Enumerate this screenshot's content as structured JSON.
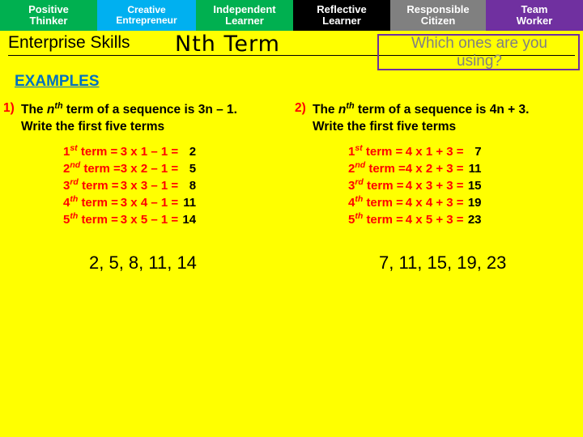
{
  "skills_bar": [
    {
      "line1": "Positive",
      "line2": "Thinker",
      "color": "#00B050"
    },
    {
      "line1": "Creative",
      "line2": "Entrepreneur",
      "color": "#00B0F0"
    },
    {
      "line1": "Independent",
      "line2": "Learner",
      "color": "#00B050"
    },
    {
      "line1": "Reflective",
      "line2": "Learner",
      "color": "#000000"
    },
    {
      "line1": "Responsible",
      "line2": "Citizen",
      "color": "#808080"
    },
    {
      "line1": "Team",
      "line2": "Worker",
      "color": "#7030A0"
    }
  ],
  "header": {
    "enterprise_skills": "Enterprise Skills",
    "title": "Nth Term",
    "question_line1": "Which ones are you",
    "question_line2": "using?",
    "question_color": "#808080",
    "question_border_color": "#7030A0"
  },
  "examples_label": "EXAMPLES",
  "examples": [
    {
      "number": "1)",
      "prompt_pre": "The ",
      "prompt_n": "n",
      "prompt_sup": "th",
      "prompt_mid": " term of a sequence is ",
      "rule": "3n – 1.",
      "prompt_line2": "Write the first five terms",
      "rows": [
        {
          "ordinal": "1",
          "ordinal_sup": "st",
          "label": "term =",
          "expr": "3 x 1 – 1 =",
          "result": "2"
        },
        {
          "ordinal": "2",
          "ordinal_sup": "nd",
          "label": "term =",
          "expr": "3 x 2 – 1 =",
          "result": "5"
        },
        {
          "ordinal": "3",
          "ordinal_sup": "rd",
          "label": "term =",
          "expr": "3 x 3 – 1 =",
          "result": "8"
        },
        {
          "ordinal": "4",
          "ordinal_sup": "th",
          "label": "term =",
          "expr": "3 x 4 – 1 =",
          "result": "11"
        },
        {
          "ordinal": "5",
          "ordinal_sup": "th",
          "label": "term =",
          "expr": "3 x 5 – 1 =",
          "result": "14"
        }
      ],
      "answer": "2, 5, 8, 11, 14"
    },
    {
      "number": "2)",
      "prompt_pre": "The ",
      "prompt_n": "n",
      "prompt_sup": "th",
      "prompt_mid": " term of a sequence is ",
      "rule": "4n + 3.",
      "prompt_line2": "Write the first five terms",
      "rows": [
        {
          "ordinal": "1",
          "ordinal_sup": "st",
          "label": "term =",
          "expr": "4 x 1 + 3 =",
          "result": "7"
        },
        {
          "ordinal": "2",
          "ordinal_sup": "nd",
          "label": "term =",
          "expr": "4 x 2 + 3 =",
          "result": "11"
        },
        {
          "ordinal": "3",
          "ordinal_sup": "rd",
          "label": "term =",
          "expr": "4 x 3 + 3 =",
          "result": "15"
        },
        {
          "ordinal": "4",
          "ordinal_sup": "th",
          "label": "term =",
          "expr": "4 x 4 + 3 =",
          "result": "19"
        },
        {
          "ordinal": "5",
          "ordinal_sup": "th",
          "label": "term =",
          "expr": "4 x 5 + 3 =",
          "result": "23"
        }
      ],
      "answer": "7, 11, 15, 19, 23"
    }
  ]
}
